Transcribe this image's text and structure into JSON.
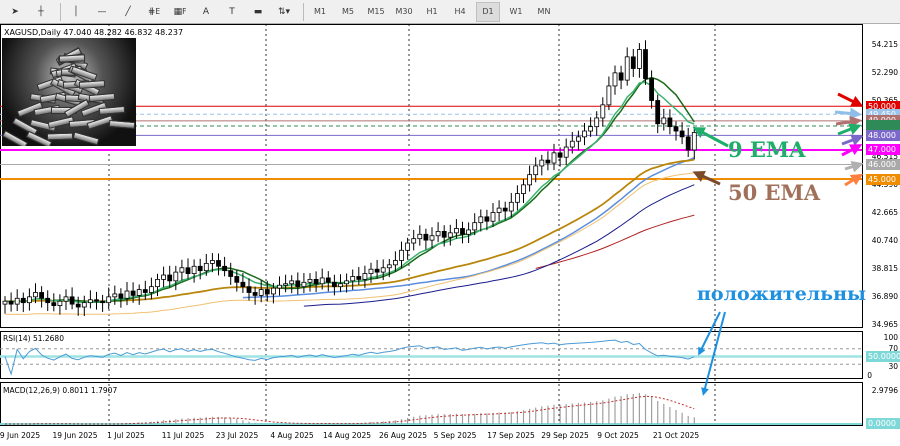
{
  "toolbar": {
    "tools": [
      "cursor-icon",
      "crosshair-icon",
      "vertical-line-icon",
      "horizontal-line-icon",
      "trendline-icon",
      "fibonacci-icon",
      "grid-icon",
      "text-icon",
      "text-label-icon",
      "rectangle-icon",
      "arrows-icon"
    ],
    "fib_sub": "E",
    "grid_sub": "F",
    "text_label": "A",
    "textbox_label": "T",
    "timeframes": [
      "M1",
      "M5",
      "M15",
      "M30",
      "H1",
      "H4",
      "D1",
      "W1",
      "MN"
    ],
    "active_timeframe": "D1"
  },
  "chart": {
    "symbol_line": "XAGUSD,Daily  47.040 48.282 46.832 48.237",
    "annotations": {
      "ema9": "9 EMA",
      "ema50": "50 EMA",
      "positive": "положительны"
    },
    "colors": {
      "bull": "#ffffff",
      "bear": "#000000",
      "ema9_fast": "#3cb371",
      "ema9_slow": "#1a6b1a",
      "ema50": "#b8860b",
      "annotation_green": "#1fae6a",
      "annotation_brown": "#a0705a",
      "annotation_blue": "#1e90e0"
    }
  },
  "chart_data": {
    "type": "candlestick",
    "closes": [
      36.6,
      36.4,
      36.8,
      36.5,
      36.9,
      37.2,
      36.8,
      36.5,
      36.3,
      36.6,
      36.9,
      36.4,
      36.2,
      36.5,
      36.7,
      36.6,
      36.5,
      36.9,
      37.1,
      36.8,
      37.3,
      37.0,
      37.4,
      37.2,
      37.6,
      38.1,
      38.4,
      38.0,
      38.6,
      38.9,
      38.5,
      39.0,
      38.7,
      39.2,
      39.4,
      39.0,
      38.7,
      38.3,
      37.9,
      37.6,
      37.2,
      37.0,
      37.4,
      37.1,
      37.5,
      37.7,
      37.8,
      38.0,
      37.6,
      37.9,
      38.1,
      37.8,
      38.2,
      37.9,
      37.6,
      37.8,
      38.0,
      38.3,
      38.1,
      38.5,
      38.8,
      38.6,
      38.9,
      39.1,
      39.4,
      40.1,
      40.6,
      40.9,
      41.2,
      40.8,
      41.1,
      41.4,
      41.0,
      41.3,
      41.6,
      41.2,
      41.5,
      42.0,
      42.4,
      42.1,
      42.7,
      43.0,
      42.8,
      43.4,
      44.0,
      44.6,
      45.3,
      45.9,
      46.3,
      46.1,
      46.8,
      46.5,
      47.2,
      47.6,
      47.9,
      48.3,
      48.6,
      49.2,
      50.1,
      51.4,
      52.3,
      51.8,
      53.4,
      52.6,
      53.9,
      51.9,
      50.4,
      48.8,
      49.2,
      48.6,
      48.3,
      47.9,
      47.0,
      48.2
    ],
    "price_ticks": [
      "54.215",
      "52.290",
      "50.365",
      "48.440",
      "46.515",
      "44.590",
      "42.665",
      "40.740",
      "38.815",
      "36.890",
      "34.965"
    ],
    "ylim": [
      34.965,
      54.215
    ],
    "date_ticks": [
      "9 Jun 2025",
      "19 Jun 2025",
      "1 Jul 2025",
      "11 Jul 2025",
      "23 Jul 2025",
      "4 Aug 2025",
      "14 Aug 2025",
      "26 Aug 2025",
      "5 Sep 2025",
      "17 Sep 2025",
      "29 Sep 2025",
      "9 Oct 2025",
      "21 Oct 2025"
    ],
    "levels": [
      {
        "value": 50.0,
        "label": "50.000",
        "color": "#e00000",
        "dash": false
      },
      {
        "value": 49.45,
        "label": "49.450",
        "color": "#9cc4ea",
        "dash": true
      },
      {
        "value": 49.0,
        "label": "49.000",
        "color": "#b07070",
        "dash": false
      },
      {
        "value": 48.65,
        "label": "",
        "color": "#2e8b57",
        "dash": true
      },
      {
        "value": 48.0,
        "label": "48.000",
        "color": "#7b68c8",
        "dash": false
      },
      {
        "value": 47.0,
        "label": "47.000",
        "color": "#ff00ff",
        "dash": false
      },
      {
        "value": 46.0,
        "label": "46.000",
        "color": "#a9a9a9",
        "dash": false
      },
      {
        "value": 45.0,
        "label": "45.000",
        "color": "#f08c00",
        "dash": false
      }
    ],
    "rsi": {
      "label": "RSI(14) 51.2680",
      "ticks": [
        "100",
        "70",
        "30",
        "0"
      ],
      "level_label": "50.0000"
    },
    "macd": {
      "label": "MACD(12,26,9) 0.8011 1.7907",
      "max_label": "2.9796",
      "zero_label": "0.0000",
      "ylim": [
        0,
        2.9796
      ]
    }
  }
}
